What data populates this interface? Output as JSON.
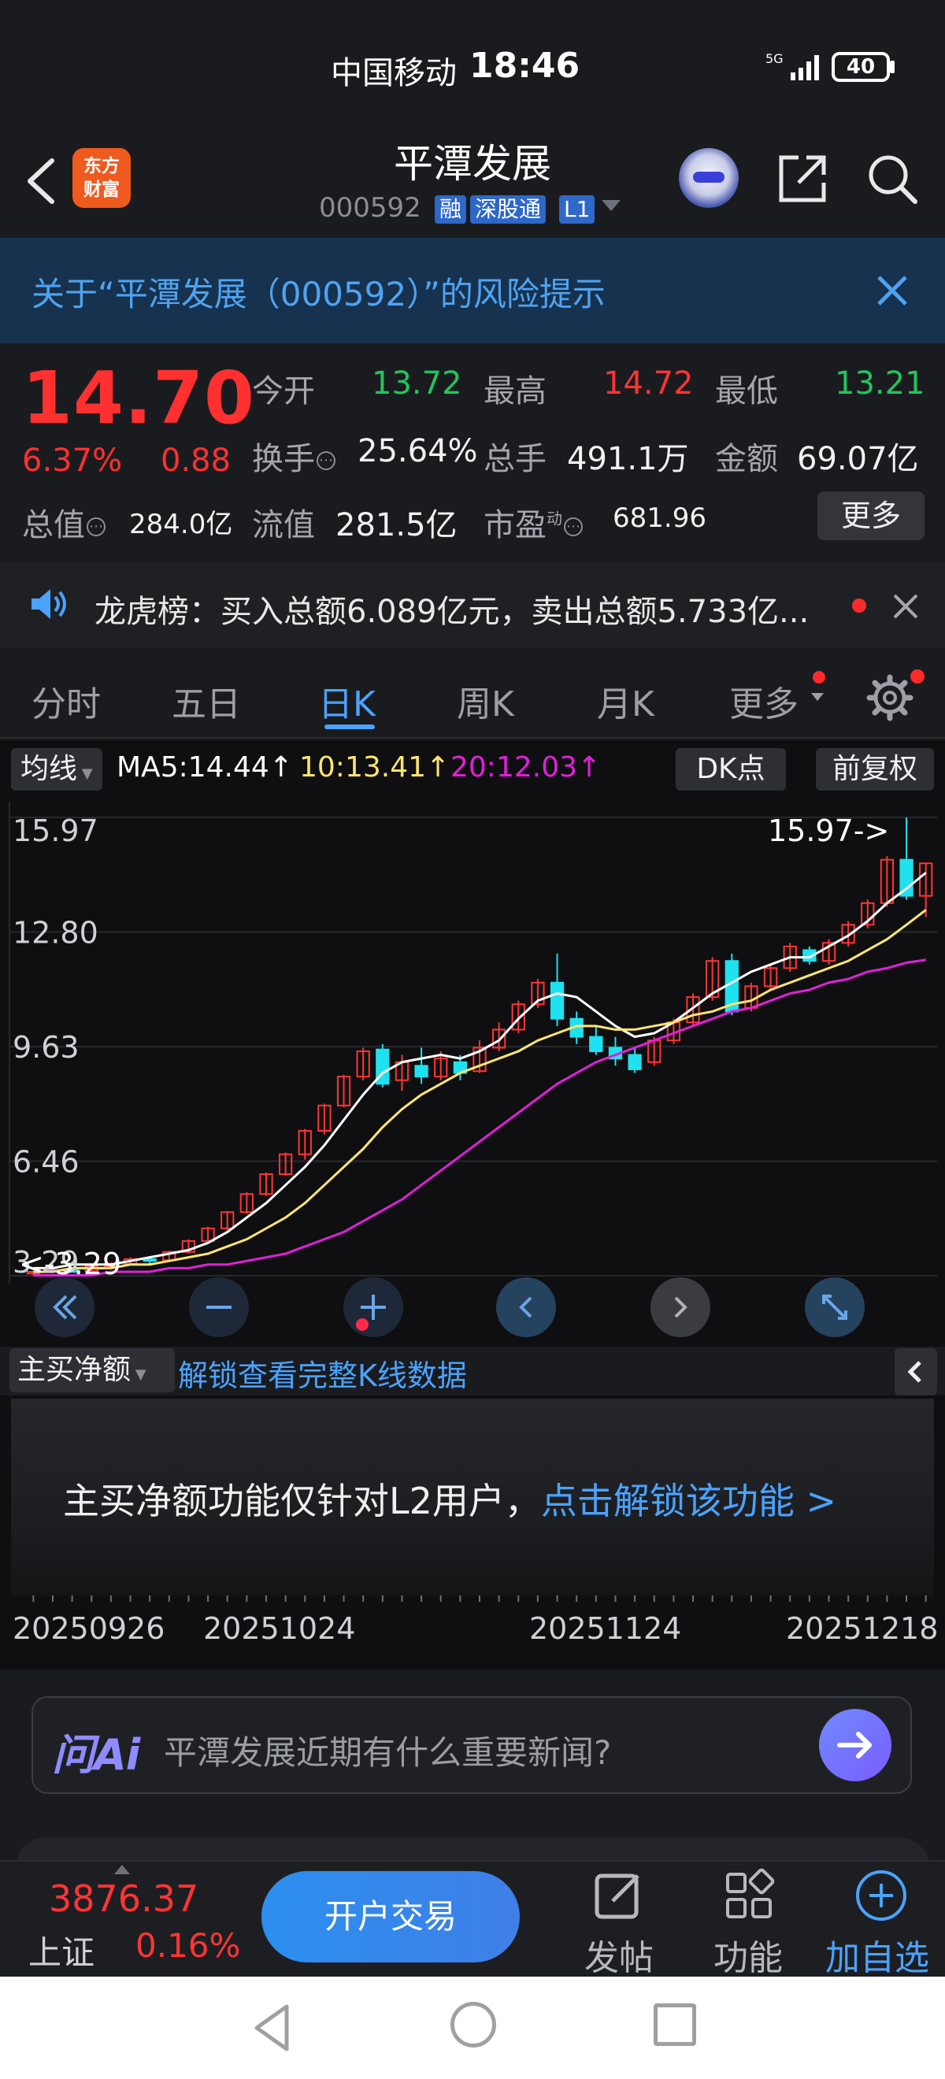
{
  "status_bar": {
    "carrier": "中国移动",
    "time": "18:46",
    "network": "5G",
    "battery": "40"
  },
  "header": {
    "logo_line1": "东方",
    "logo_line2": "财富",
    "stock_name": "平潭发展",
    "stock_code": "000592",
    "tags": [
      "融",
      "深股通",
      "L1"
    ]
  },
  "risk_banner": {
    "text": "关于“平潭发展（000592）”的风险提示"
  },
  "quote": {
    "price": "14.70",
    "change_pct": "6.37%",
    "change": "0.88",
    "open_label": "今开",
    "open": "13.72",
    "high_label": "最高",
    "high": "14.72",
    "low_label": "最低",
    "low": "13.21",
    "turnover_label": "换手",
    "turnover": "25.64%",
    "volume_label": "总手",
    "volume": "491.1万",
    "amount_label": "金额",
    "amount": "69.07亿",
    "mktcap_label": "总值",
    "mktcap": "284.0亿",
    "float_label": "流值",
    "float_cap": "281.5亿",
    "pe_label": "市盈",
    "pe_sup": "动",
    "pe": "681.96",
    "more_button": "更多"
  },
  "dragon_tiger": {
    "text": "龙虎榜：买入总额6.089亿元，卖出总额5.733亿..."
  },
  "tabs": [
    {
      "label": "分时",
      "active": false
    },
    {
      "label": "五日",
      "active": false
    },
    {
      "label": "日K",
      "active": true
    },
    {
      "label": "周K",
      "active": false
    },
    {
      "label": "月K",
      "active": false
    },
    {
      "label": "更多",
      "active": false
    }
  ],
  "chart_toolbar": {
    "ma_select": "均线",
    "ma5": "MA5:14.44↑",
    "ma10": "10:13.41↑",
    "ma20": "20:12.03↑",
    "dk_button": "DK点",
    "adjust_button": "前复权"
  },
  "chart_data": {
    "type": "candlestick",
    "y_ticks": [
      "15.97",
      "12.80",
      "9.63",
      "6.46",
      "3.29"
    ],
    "ylim": [
      3.29,
      15.97
    ],
    "max_marker": "15.97->",
    "min_marker": "<-3.29",
    "series": [
      {
        "name": "MA5",
        "color": "#ffffff",
        "values": [
          3.5,
          3.5,
          3.6,
          3.6,
          3.6,
          3.7,
          3.8,
          3.9,
          4.0,
          4.2,
          4.5,
          4.9,
          5.3,
          5.8,
          6.3,
          6.9,
          7.6,
          8.3,
          8.9,
          9.2,
          9.3,
          9.4,
          9.3,
          9.5,
          9.8,
          10.4,
          10.9,
          11.1,
          11.0,
          10.6,
          10.2,
          9.9,
          10.0,
          10.3,
          10.7,
          11.1,
          11.4,
          11.7,
          11.9,
          12.1,
          12.1,
          12.4,
          12.7,
          13.1,
          13.6,
          14.0,
          14.44
        ]
      },
      {
        "name": "MA10",
        "color": "#ffe66d",
        "values": [
          3.4,
          3.4,
          3.5,
          3.5,
          3.5,
          3.6,
          3.6,
          3.7,
          3.8,
          3.9,
          4.1,
          4.3,
          4.6,
          4.9,
          5.3,
          5.8,
          6.3,
          6.8,
          7.4,
          7.9,
          8.3,
          8.6,
          8.9,
          9.1,
          9.3,
          9.5,
          9.8,
          10.0,
          10.2,
          10.2,
          10.1,
          10.1,
          10.2,
          10.3,
          10.5,
          10.6,
          10.8,
          10.9,
          11.2,
          11.4,
          11.6,
          11.8,
          12.0,
          12.3,
          12.6,
          13.0,
          13.41
        ]
      },
      {
        "name": "MA20",
        "color": "#e020d8",
        "values": [
          3.3,
          3.3,
          3.3,
          3.3,
          3.4,
          3.4,
          3.4,
          3.5,
          3.5,
          3.6,
          3.6,
          3.7,
          3.8,
          3.9,
          4.1,
          4.3,
          4.5,
          4.8,
          5.1,
          5.4,
          5.8,
          6.2,
          6.6,
          7.0,
          7.4,
          7.8,
          8.2,
          8.6,
          8.9,
          9.2,
          9.4,
          9.6,
          9.8,
          10.0,
          10.2,
          10.4,
          10.6,
          10.7,
          10.9,
          11.1,
          11.2,
          11.4,
          11.5,
          11.7,
          11.8,
          11.95,
          12.03
        ]
      }
    ],
    "candles": [
      [
        3.35,
        3.4,
        3.3,
        3.42
      ],
      [
        3.4,
        3.45,
        3.36,
        3.48
      ],
      [
        3.44,
        3.42,
        3.38,
        3.5
      ],
      [
        3.42,
        3.55,
        3.4,
        3.58
      ],
      [
        3.55,
        3.62,
        3.5,
        3.66
      ],
      [
        3.62,
        3.75,
        3.58,
        3.8
      ],
      [
        3.75,
        3.7,
        3.6,
        3.82
      ],
      [
        3.72,
        3.95,
        3.7,
        3.98
      ],
      [
        3.95,
        4.25,
        3.9,
        4.3
      ],
      [
        4.25,
        4.6,
        4.2,
        4.65
      ],
      [
        4.6,
        5.05,
        4.55,
        5.08
      ],
      [
        5.05,
        5.55,
        5.0,
        5.6
      ],
      [
        5.55,
        6.1,
        5.5,
        6.15
      ],
      [
        6.1,
        6.65,
        6.05,
        6.7
      ],
      [
        6.65,
        7.3,
        6.5,
        7.35
      ],
      [
        7.3,
        8.0,
        7.2,
        8.05
      ],
      [
        8.0,
        8.8,
        7.95,
        8.85
      ],
      [
        8.8,
        9.5,
        8.7,
        9.6
      ],
      [
        9.55,
        8.6,
        8.5,
        9.7
      ],
      [
        8.7,
        9.2,
        8.4,
        9.4
      ],
      [
        9.1,
        8.8,
        8.6,
        9.6
      ],
      [
        8.8,
        9.3,
        8.7,
        9.5
      ],
      [
        9.2,
        8.9,
        8.7,
        9.4
      ],
      [
        8.95,
        9.6,
        8.9,
        9.8
      ],
      [
        9.6,
        10.1,
        9.5,
        10.3
      ],
      [
        10.1,
        10.8,
        10.0,
        10.9
      ],
      [
        10.8,
        11.4,
        10.7,
        11.5
      ],
      [
        11.4,
        10.4,
        10.2,
        12.2
      ],
      [
        10.4,
        9.9,
        9.7,
        10.6
      ],
      [
        9.9,
        9.5,
        9.4,
        10.2
      ],
      [
        9.6,
        9.3,
        9.1,
        9.9
      ],
      [
        9.4,
        9.0,
        8.9,
        9.6
      ],
      [
        9.2,
        9.8,
        9.1,
        9.9
      ],
      [
        9.8,
        10.3,
        9.7,
        10.4
      ],
      [
        10.3,
        11.0,
        10.2,
        11.1
      ],
      [
        11.0,
        12.0,
        10.9,
        12.1
      ],
      [
        12.0,
        10.6,
        10.5,
        12.2
      ],
      [
        10.7,
        11.3,
        10.6,
        11.4
      ],
      [
        11.3,
        11.8,
        11.2,
        11.9
      ],
      [
        11.8,
        12.4,
        11.7,
        12.5
      ],
      [
        12.3,
        12.0,
        11.9,
        12.4
      ],
      [
        12.0,
        12.5,
        11.9,
        12.6
      ],
      [
        12.5,
        13.0,
        12.4,
        13.1
      ],
      [
        13.0,
        13.6,
        12.9,
        13.7
      ],
      [
        13.6,
        14.8,
        13.5,
        14.9
      ],
      [
        14.8,
        13.8,
        13.7,
        15.97
      ],
      [
        13.8,
        14.7,
        13.21,
        14.72
      ]
    ],
    "x_ticks": [
      "20250926",
      "20251024",
      "20251124",
      "20251218"
    ]
  },
  "sub_indicator": {
    "select": "主买净额",
    "unlock_link": "解锁查看完整K线数据",
    "message": "主买净额功能仅针对L2用户，",
    "message_link": "点击解锁该功能 >"
  },
  "ai": {
    "logo": "问Ai",
    "placeholder": "平潭发展近期有什么重要新闻?"
  },
  "bottom_bar": {
    "index_value": "3876.37",
    "index_name": "上证",
    "index_pct": "0.16%",
    "trade_button": "开户交易",
    "post": "发帖",
    "functions": "功能",
    "add_watch": "加自选"
  }
}
